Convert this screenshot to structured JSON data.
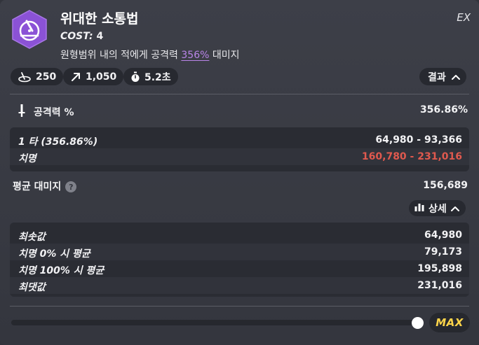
{
  "skill": {
    "name": "위대한 소통법",
    "cost_label": "COST:",
    "cost_value": "4",
    "desc_prefix": "원형범위 내의 적에게 공격력 ",
    "desc_highlight": "356%",
    "desc_suffix": " 대미지",
    "grade": "EX"
  },
  "stats": {
    "range": "250",
    "radius": "1,050",
    "cooldown": "5.2초"
  },
  "result_toggle": {
    "label": "결과",
    "expanded": true
  },
  "atk_row": {
    "label": "공격력 %",
    "value": "356.86%"
  },
  "hit_table": [
    {
      "label": "1 타 (356.86%)",
      "value": "64,980 - 93,366"
    },
    {
      "label": "치명",
      "value": "160,780 - 231,016"
    }
  ],
  "avg_row": {
    "label": "평균 대미지",
    "value": "156,689"
  },
  "detail_toggle": {
    "label": "상세",
    "expanded": true
  },
  "detail_table": [
    {
      "label": "최솟값",
      "value": "64,980"
    },
    {
      "label": "치명 0% 시 평균",
      "value": "79,173"
    },
    {
      "label": "치명 100% 시 평균",
      "value": "195,898"
    },
    {
      "label": "최댓값",
      "value": "231,016"
    }
  ],
  "level_slider": {
    "fill_fraction": 1.0
  },
  "max_button": {
    "label": "MAX"
  },
  "colors": {
    "accent_purple": "#b985e8",
    "critical_red": "#e0594e",
    "max_yellow": "#ffd54a",
    "icon_purple": "#8b52d6"
  }
}
